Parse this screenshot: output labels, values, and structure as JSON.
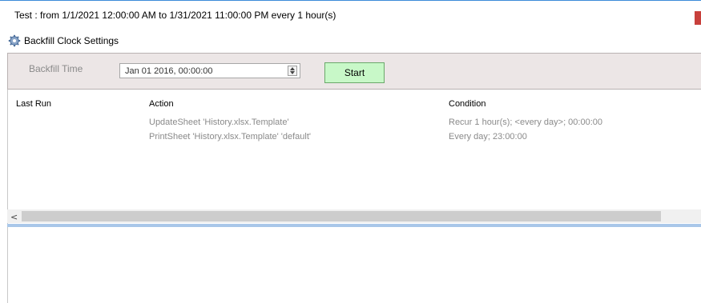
{
  "window": {
    "title": "Test : from 1/1/2021 12:00:00 AM to 1/31/2021 11:00:00 PM every 1 hour(s)"
  },
  "colors": {
    "accent_border": "#3c8bd9",
    "indicator_red": "#c8403c",
    "start_button_bg": "#c8f8c8",
    "panel_bg": "#ece6e6",
    "splitter": "#a9c7e9"
  },
  "section": {
    "icon": "gear-icon",
    "label": "Backfill Clock Settings"
  },
  "settings": {
    "backfill_label": "Backfill Time",
    "datetime_value": "Jan 01 2016, 00:00:00",
    "start_label": "Start"
  },
  "grid": {
    "columns": [
      "Last Run",
      "Action",
      "Condition"
    ],
    "rows": [
      {
        "last_run": "",
        "action": "UpdateSheet 'History.xlsx.Template'",
        "condition": "Recur 1 hour(s); <every day>; 00:00:00"
      },
      {
        "last_run": "",
        "action": "PrintSheet 'History.xlsx.Template' 'default'",
        "condition": "Every day; 23:00:00"
      }
    ]
  },
  "scrollbar": {
    "left_arrow": "<"
  }
}
